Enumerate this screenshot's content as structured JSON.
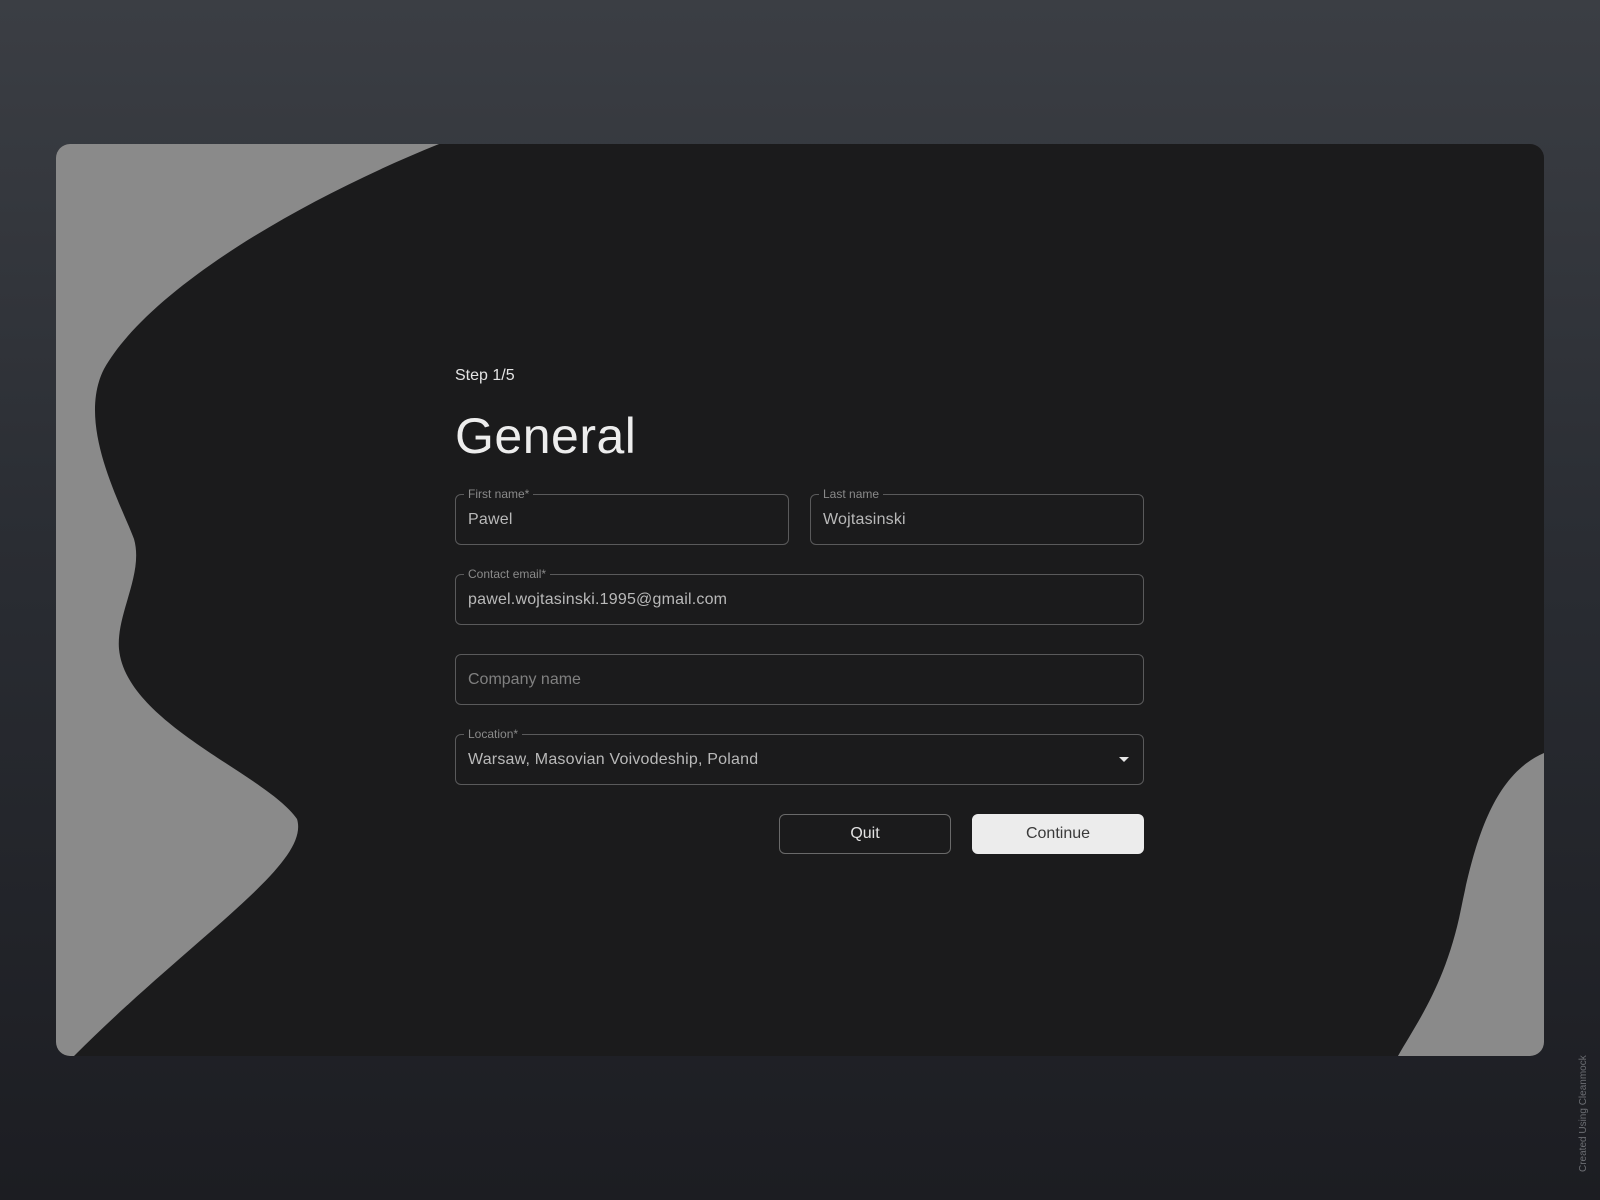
{
  "form": {
    "step_label": "Step 1/5",
    "title": "General",
    "first_name": {
      "label": "First name*",
      "value": "Pawel"
    },
    "last_name": {
      "label": "Last name",
      "value": "Wojtasinski"
    },
    "contact_email": {
      "label": "Contact email*",
      "value": "pawel.wojtasinski.1995@gmail.com"
    },
    "company_name": {
      "placeholder": "Company name"
    },
    "location": {
      "label": "Location*",
      "value": "Warsaw, Masovian Voivodeship, Poland"
    }
  },
  "actions": {
    "quit_label": "Quit",
    "continue_label": "Continue"
  },
  "watermark": "Created Using Cleanmock",
  "colors": {
    "card_background": "#1b1b1c",
    "blob": "#8a8a8a",
    "continue_button": "#ececec"
  }
}
